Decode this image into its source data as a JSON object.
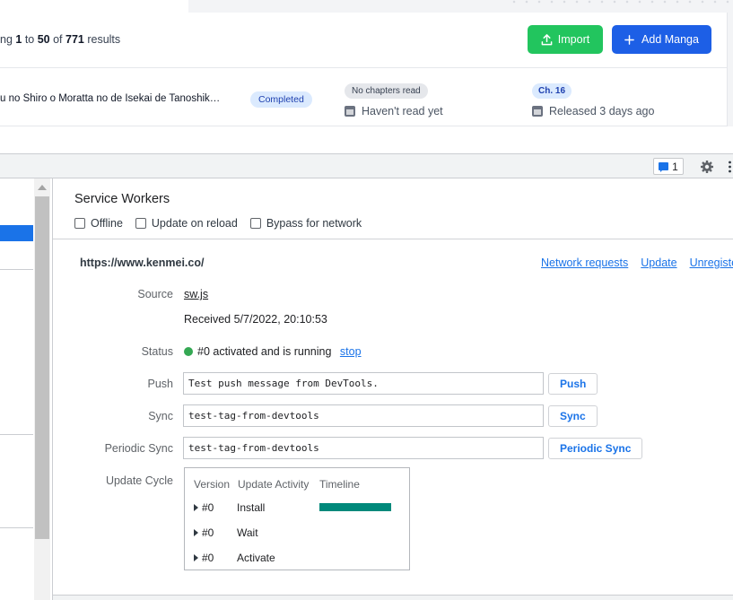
{
  "web": {
    "results_prefix": "ng ",
    "results_from": "1",
    "results_to_word": " to ",
    "results_to": "50",
    "results_of_word": " of ",
    "results_total": "771",
    "results_suffix": " results",
    "import_label": "Import",
    "add_label": "Add Manga",
    "manga_title": "u no Shiro o Moratta no de Isekai de Tanoshik…",
    "status_badge": "Completed",
    "chapters_read_badge": "No chapters read",
    "last_read_text": "Haven't read yet",
    "latest_chapter_badge": "Ch. 16",
    "released_text": "Released 3 days ago",
    "colors": {
      "import": "#22c55e",
      "add": "#1d5fe6"
    }
  },
  "toolbar": {
    "issues_count": "1",
    "icons": [
      "issue-icon",
      "gear-icon",
      "kebab-menu-icon"
    ]
  },
  "sw": {
    "title": "Service Workers",
    "options": [
      "Offline",
      "Update on reload",
      "Bypass for network"
    ],
    "origin": "https://www.kenmei.co/",
    "links": [
      "Network requests",
      "Update",
      "Unregister"
    ],
    "source_label": "Source",
    "source_value": "sw.js",
    "received": "Received 5/7/2022, 20:10:53",
    "status_label": "Status",
    "status_value": "#0 activated and is running",
    "status_link": "stop",
    "push_label": "Push",
    "push_value": "Test push message from DevTools.",
    "push_button": "Push",
    "sync_label": "Sync",
    "sync_value": "test-tag-from-devtools",
    "sync_button": "Sync",
    "periodic_label": "Periodic Sync",
    "periodic_value": "test-tag-from-devtools",
    "periodic_button": "Periodic Sync",
    "cycle_label": "Update Cycle",
    "cycle_headers": [
      "Version",
      "Update Activity",
      "Timeline"
    ],
    "cycle_rows": [
      {
        "version": "#0",
        "activity": "Install"
      },
      {
        "version": "#0",
        "activity": "Wait"
      },
      {
        "version": "#0",
        "activity": "Activate"
      }
    ],
    "colors": {
      "link": "#1a73e8",
      "status_dot": "#34a853",
      "timeline": "#00897b"
    }
  }
}
